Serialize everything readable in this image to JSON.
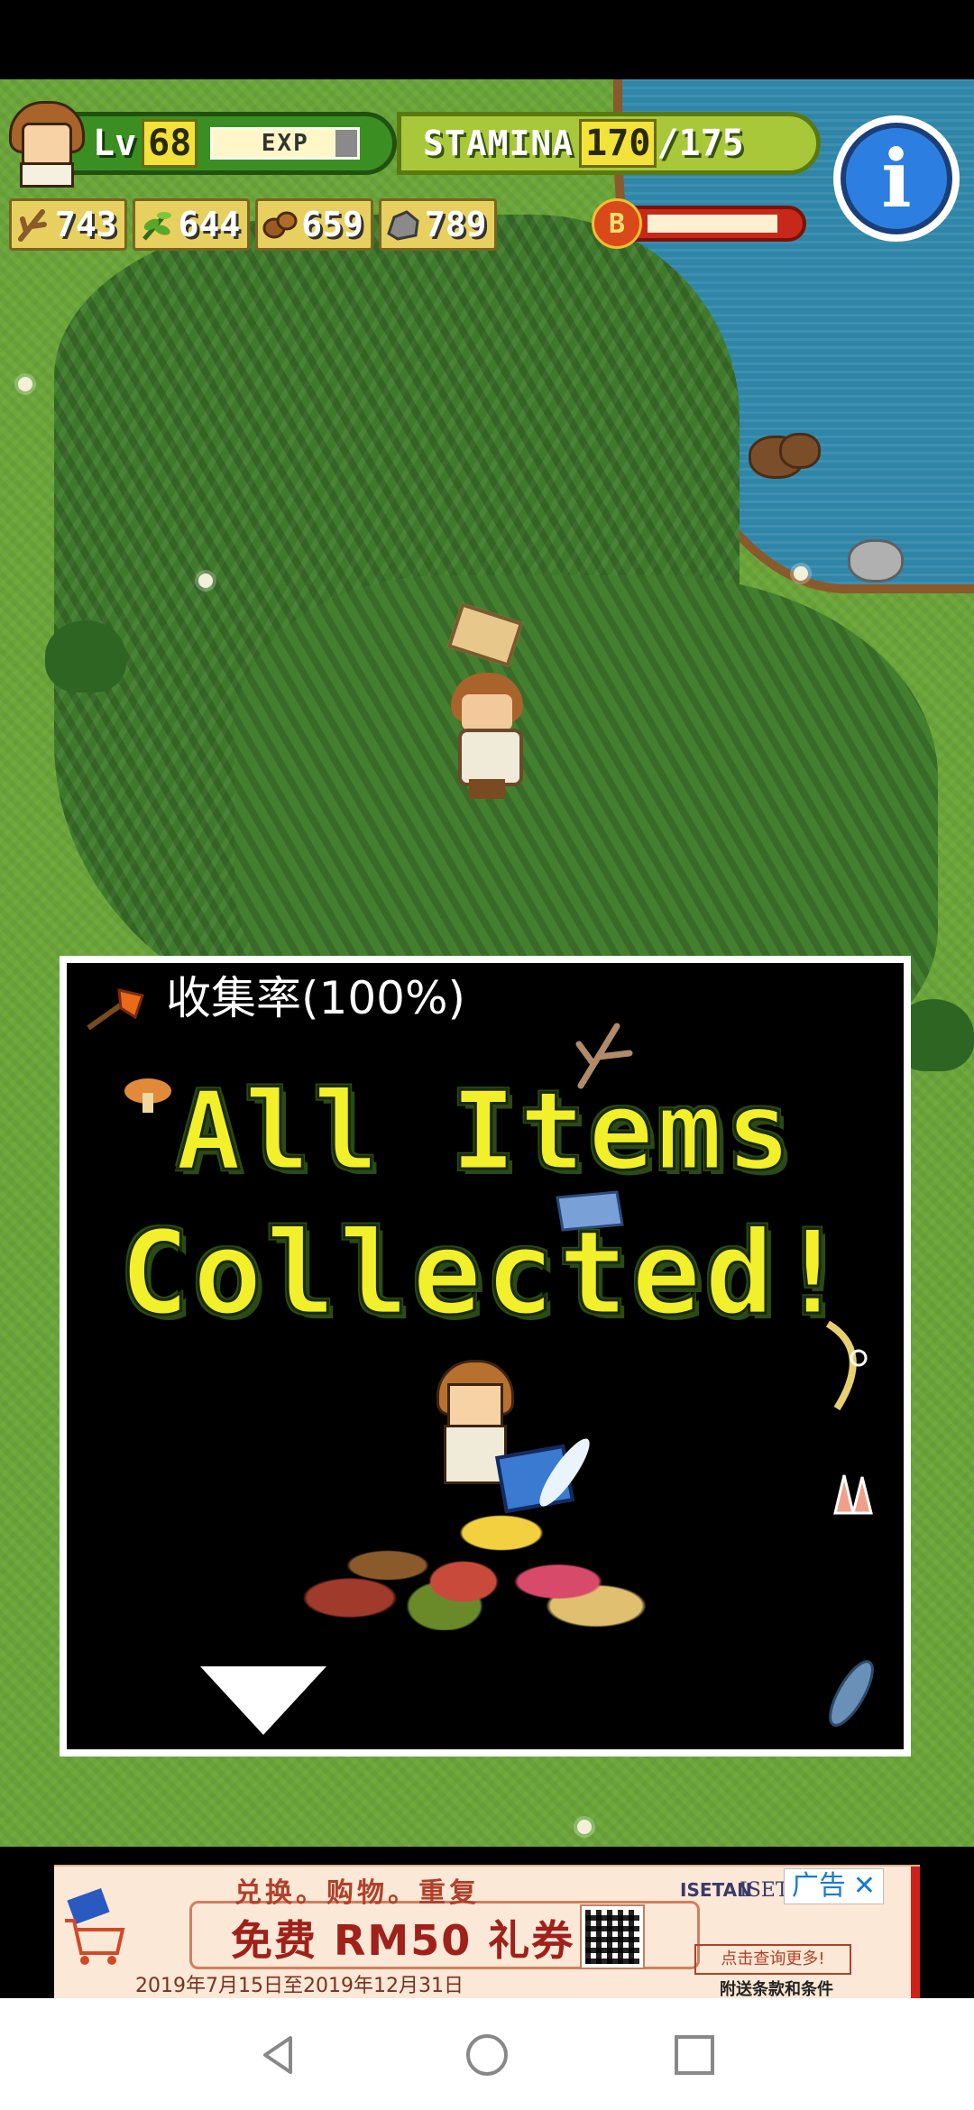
{
  "hud": {
    "level_label": "Lv",
    "level_value": "68",
    "exp_label": "EXP",
    "exp_fraction": 0.85,
    "stamina_label": "STAMINA",
    "stamina_current": "170",
    "stamina_separator": "/",
    "stamina_max": "175",
    "info_label": "i"
  },
  "resources": [
    {
      "icon": "branch-icon",
      "value": "743"
    },
    {
      "icon": "herb-icon",
      "value": "644"
    },
    {
      "icon": "nut-icon",
      "value": "659"
    },
    {
      "icon": "stone-icon",
      "value": "789"
    }
  ],
  "boost": {
    "icon_label": "B",
    "fraction": 0.9
  },
  "dialog": {
    "title": "收集率(100%)",
    "headline_line1": "All Items",
    "headline_line2": "Collected!"
  },
  "ad": {
    "top_text": "兑换。购物。重复",
    "main_text": "免费 RM50 礼券",
    "date_text": "2019年7月15日至2019年12月31日",
    "brand_small": "ISETAN",
    "brand": "ISETAN",
    "more_button": "点击查询更多!",
    "terms": "附送条款和条件",
    "badge_label": "广告",
    "close_label": "✕"
  },
  "colors": {
    "headline": "#f2f02a",
    "hud_green": "#3b8f22",
    "stamina_green": "#a8c83a",
    "info_blue": "#2c7fe0",
    "grass": "#6aa638"
  }
}
